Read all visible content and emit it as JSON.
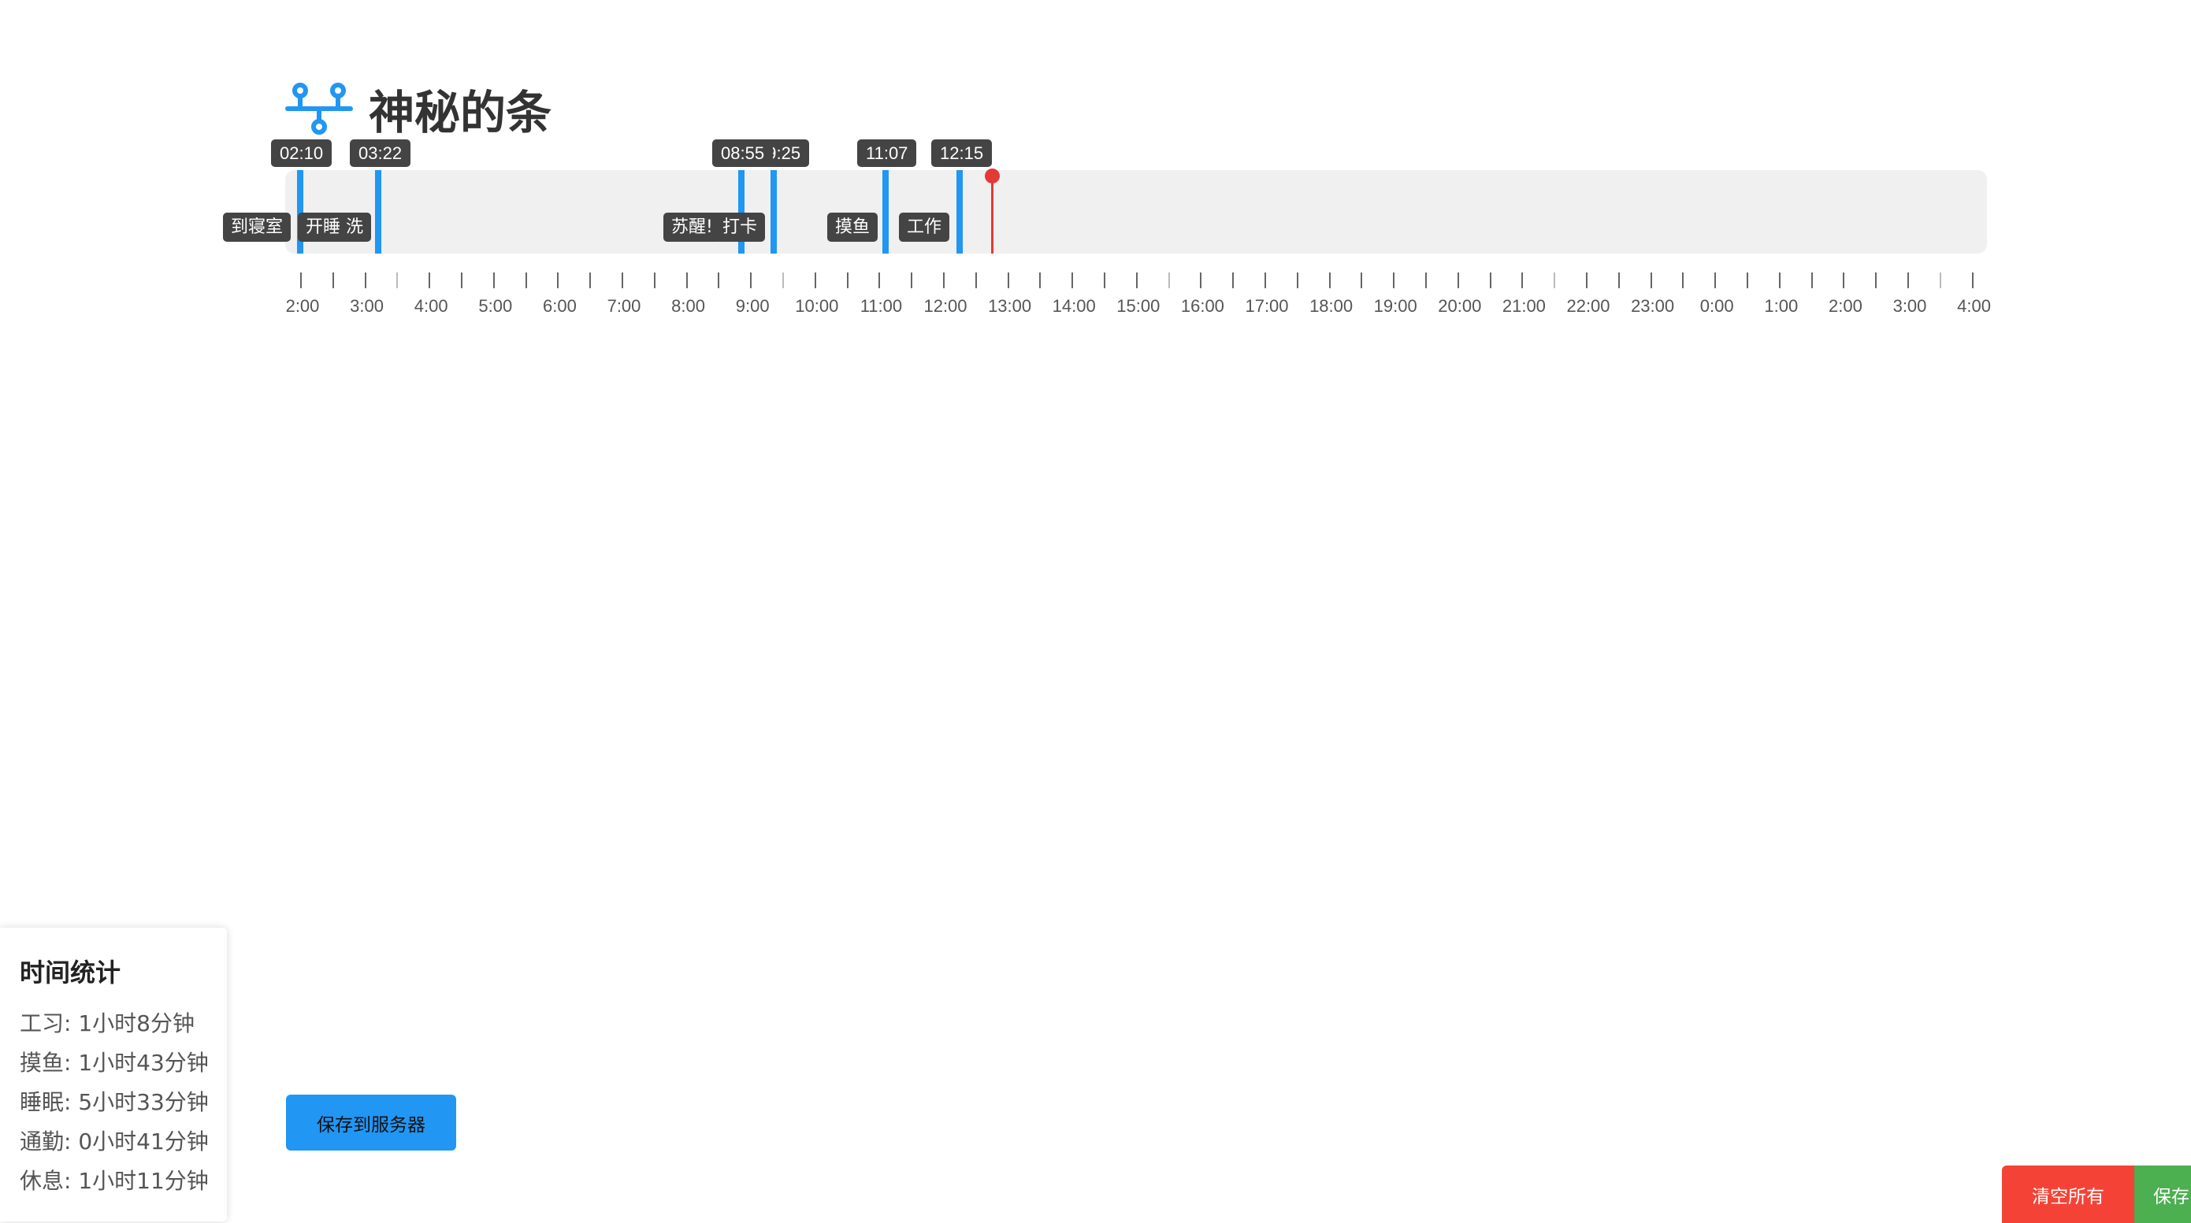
{
  "header": {
    "title": "神秘的条",
    "icon": "timeline-network-icon",
    "accent_color": "#2196f3"
  },
  "timeline": {
    "events": [
      {
        "time": "02:10",
        "label": "到寝室"
      },
      {
        "time": "03:22",
        "label": "开睡 洗"
      },
      {
        "time": "08:55",
        "label": "苏醒!"
      },
      {
        "time": "09:25",
        "label": "打卡"
      },
      {
        "time": "11:07",
        "label": "摸鱼"
      },
      {
        "time": "12:15",
        "label": "工作"
      }
    ],
    "current_time_marker_color": "#e53935",
    "axis_ticks": [
      "2:00",
      "3:00",
      "4:00",
      "5:00",
      "6:00",
      "7:00",
      "8:00",
      "9:00",
      "10:00",
      "11:00",
      "12:00",
      "13:00",
      "14:00",
      "15:00",
      "16:00",
      "17:00",
      "18:00",
      "19:00",
      "20:00",
      "21:00",
      "22:00",
      "23:00",
      "0:00",
      "1:00",
      "2:00",
      "3:00",
      "4:00"
    ]
  },
  "stats": {
    "title": "时间统计",
    "rows": [
      "工习: 1小时8分钟",
      "摸鱼: 1小时43分钟",
      "睡眠: 5小时33分钟",
      "通勤: 0小时41分钟",
      "休息: 1小时11分钟"
    ]
  },
  "buttons": {
    "save_server": "保存到服务器",
    "clear_all": "清空所有",
    "save": "保存"
  }
}
